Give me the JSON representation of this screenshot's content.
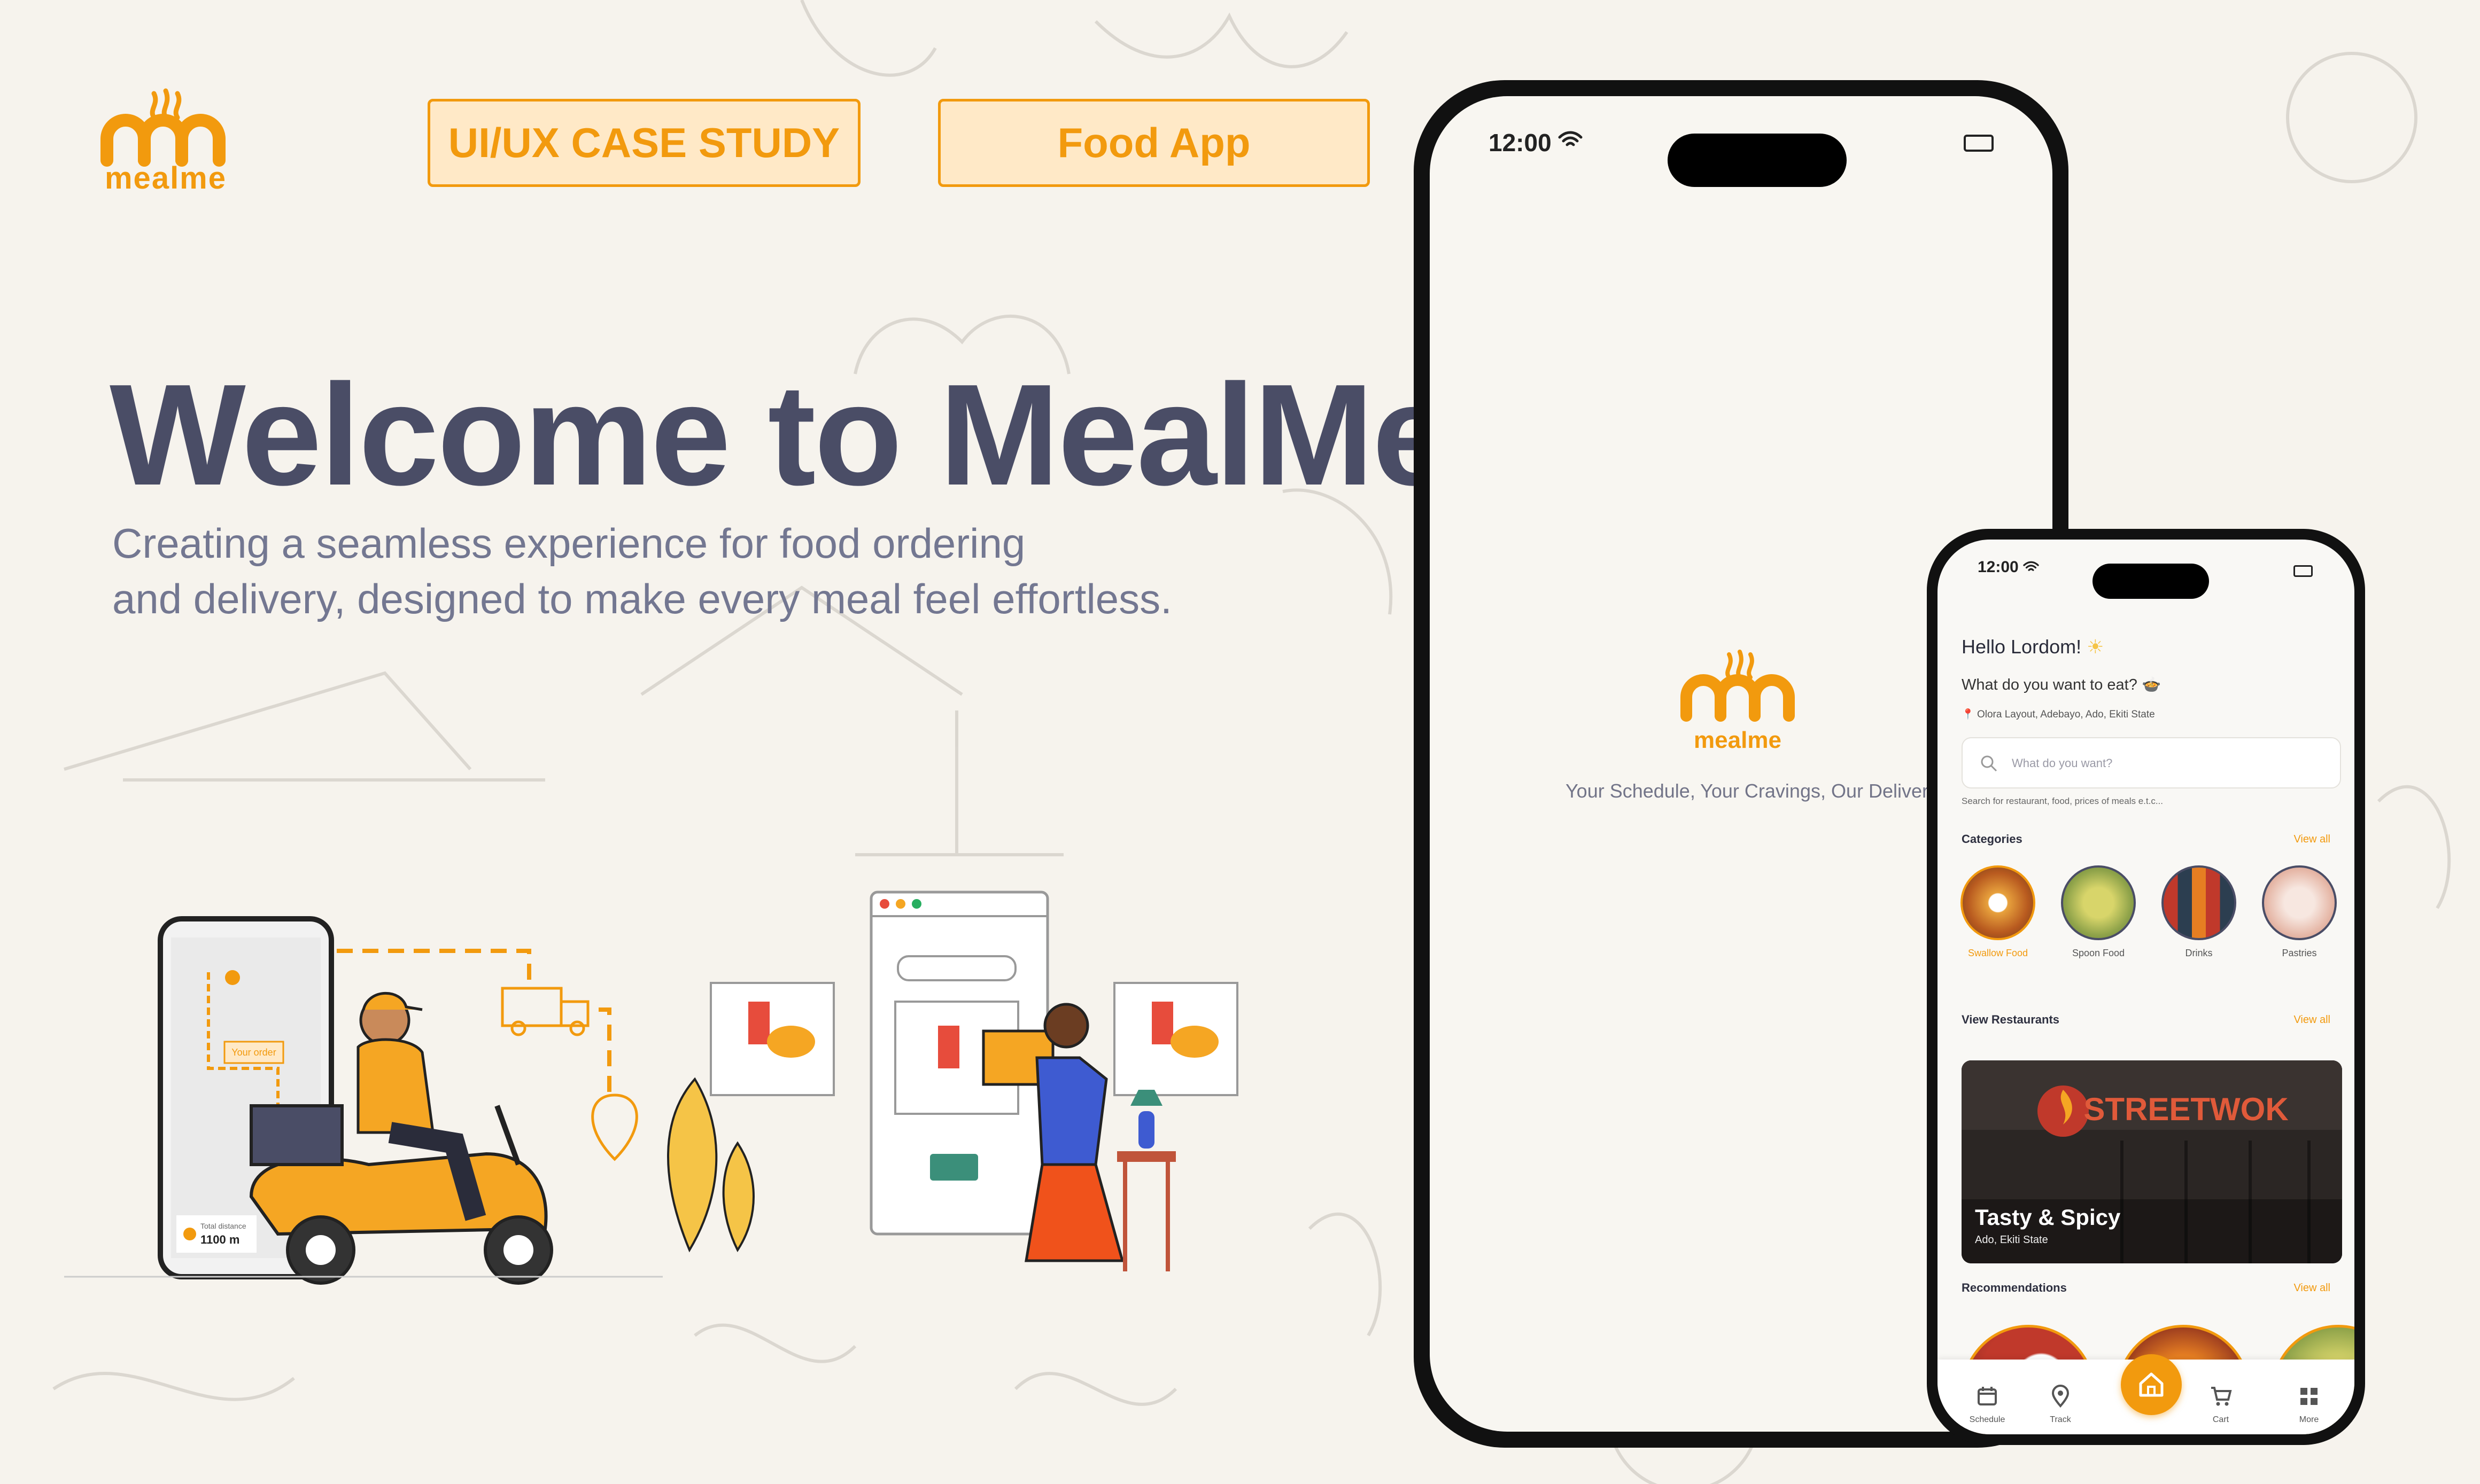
{
  "brand": {
    "logo_text": "mealme",
    "accent": "#f29a0e",
    "tag_bg": "#ffe9c7",
    "text_dark": "#4a4d66"
  },
  "tags": {
    "case_study": "UI/UX CASE STUDY",
    "app_type": "Food App"
  },
  "hero": {
    "title": "Welcome to MealMe",
    "subtitle_line1": "Creating a seamless experience for food ordering",
    "subtitle_line2": "and delivery, designed to make every meal feel effortless."
  },
  "illustration": {
    "map_marker": "Your order",
    "distance_label": "Total distance",
    "distance_value": "1100 m"
  },
  "splash_phone": {
    "time": "12:00",
    "tagline": "Your Schedule, Your Cravings, Our Delivery"
  },
  "home_phone": {
    "time": "12:00",
    "greeting": "Hello Lordom!",
    "question": "What do you want to eat?",
    "location": "Olora Layout, Adebayo, Ado, Ekiti State",
    "search": {
      "placeholder": "What do you want?",
      "hint": "Search for restaurant, food, prices of meals e.t.c..."
    },
    "categories_title": "Categories",
    "view_all": "View all",
    "categories": [
      {
        "label": "Swallow Food",
        "active": true
      },
      {
        "label": "Spoon Food",
        "active": false
      },
      {
        "label": "Drinks",
        "active": false
      },
      {
        "label": "Pastries",
        "active": false
      }
    ],
    "restaurants_title": "View Restaurants",
    "restaurant": {
      "sign": "STREETWOK",
      "name": "Tasty & Spicy",
      "location": "Ado, Ekiti State"
    },
    "recommendations_title": "Recommendations",
    "nav": [
      {
        "label": "Schedule",
        "icon": "calendar-icon"
      },
      {
        "label": "Track",
        "icon": "location-pin-icon"
      },
      {
        "label": "Home",
        "icon": "home-icon"
      },
      {
        "label": "Cart",
        "icon": "cart-icon"
      },
      {
        "label": "More",
        "icon": "grid-icon"
      }
    ]
  }
}
